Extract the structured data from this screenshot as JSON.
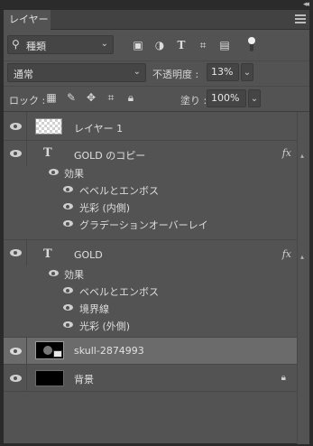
{
  "panel": {
    "tab_label": "レイヤー",
    "collapse_glyph": "◂◂"
  },
  "filter": {
    "kind_label": "種類",
    "icons": [
      "image-filter-icon",
      "adjustment-filter-icon",
      "type-filter-icon",
      "shape-filter-icon",
      "smart-object-filter-icon",
      "filter-toggle-icon"
    ]
  },
  "blend": {
    "mode": "通常",
    "opacity_label": "不透明度 :",
    "opacity_value": "13%"
  },
  "lock": {
    "label": "ロック :",
    "fill_label": "塗り :",
    "fill_value": "100%"
  },
  "layers": [
    {
      "name": "レイヤー 1",
      "type": "pixel",
      "visible": true
    },
    {
      "name": "GOLD のコピー",
      "type": "text",
      "visible": true,
      "fx": "fx",
      "effects_label": "効果",
      "effects": [
        "ベベルとエンボス",
        "光彩 (内側)",
        "グラデーションオーバーレイ"
      ]
    },
    {
      "name": "GOLD",
      "type": "text",
      "visible": true,
      "fx": "fx",
      "effects_label": "効果",
      "effects": [
        "ベベルとエンボス",
        "境界線",
        "光彩 (外側)"
      ]
    },
    {
      "name": "skull-2874993",
      "type": "smart-object",
      "visible": true,
      "selected": true
    },
    {
      "name": "背景",
      "type": "background",
      "visible": true,
      "locked": true
    }
  ],
  "colors": {
    "panel_bg": "#535353",
    "selected_row": "#6b6b6b",
    "text": "#e0e0e0"
  }
}
